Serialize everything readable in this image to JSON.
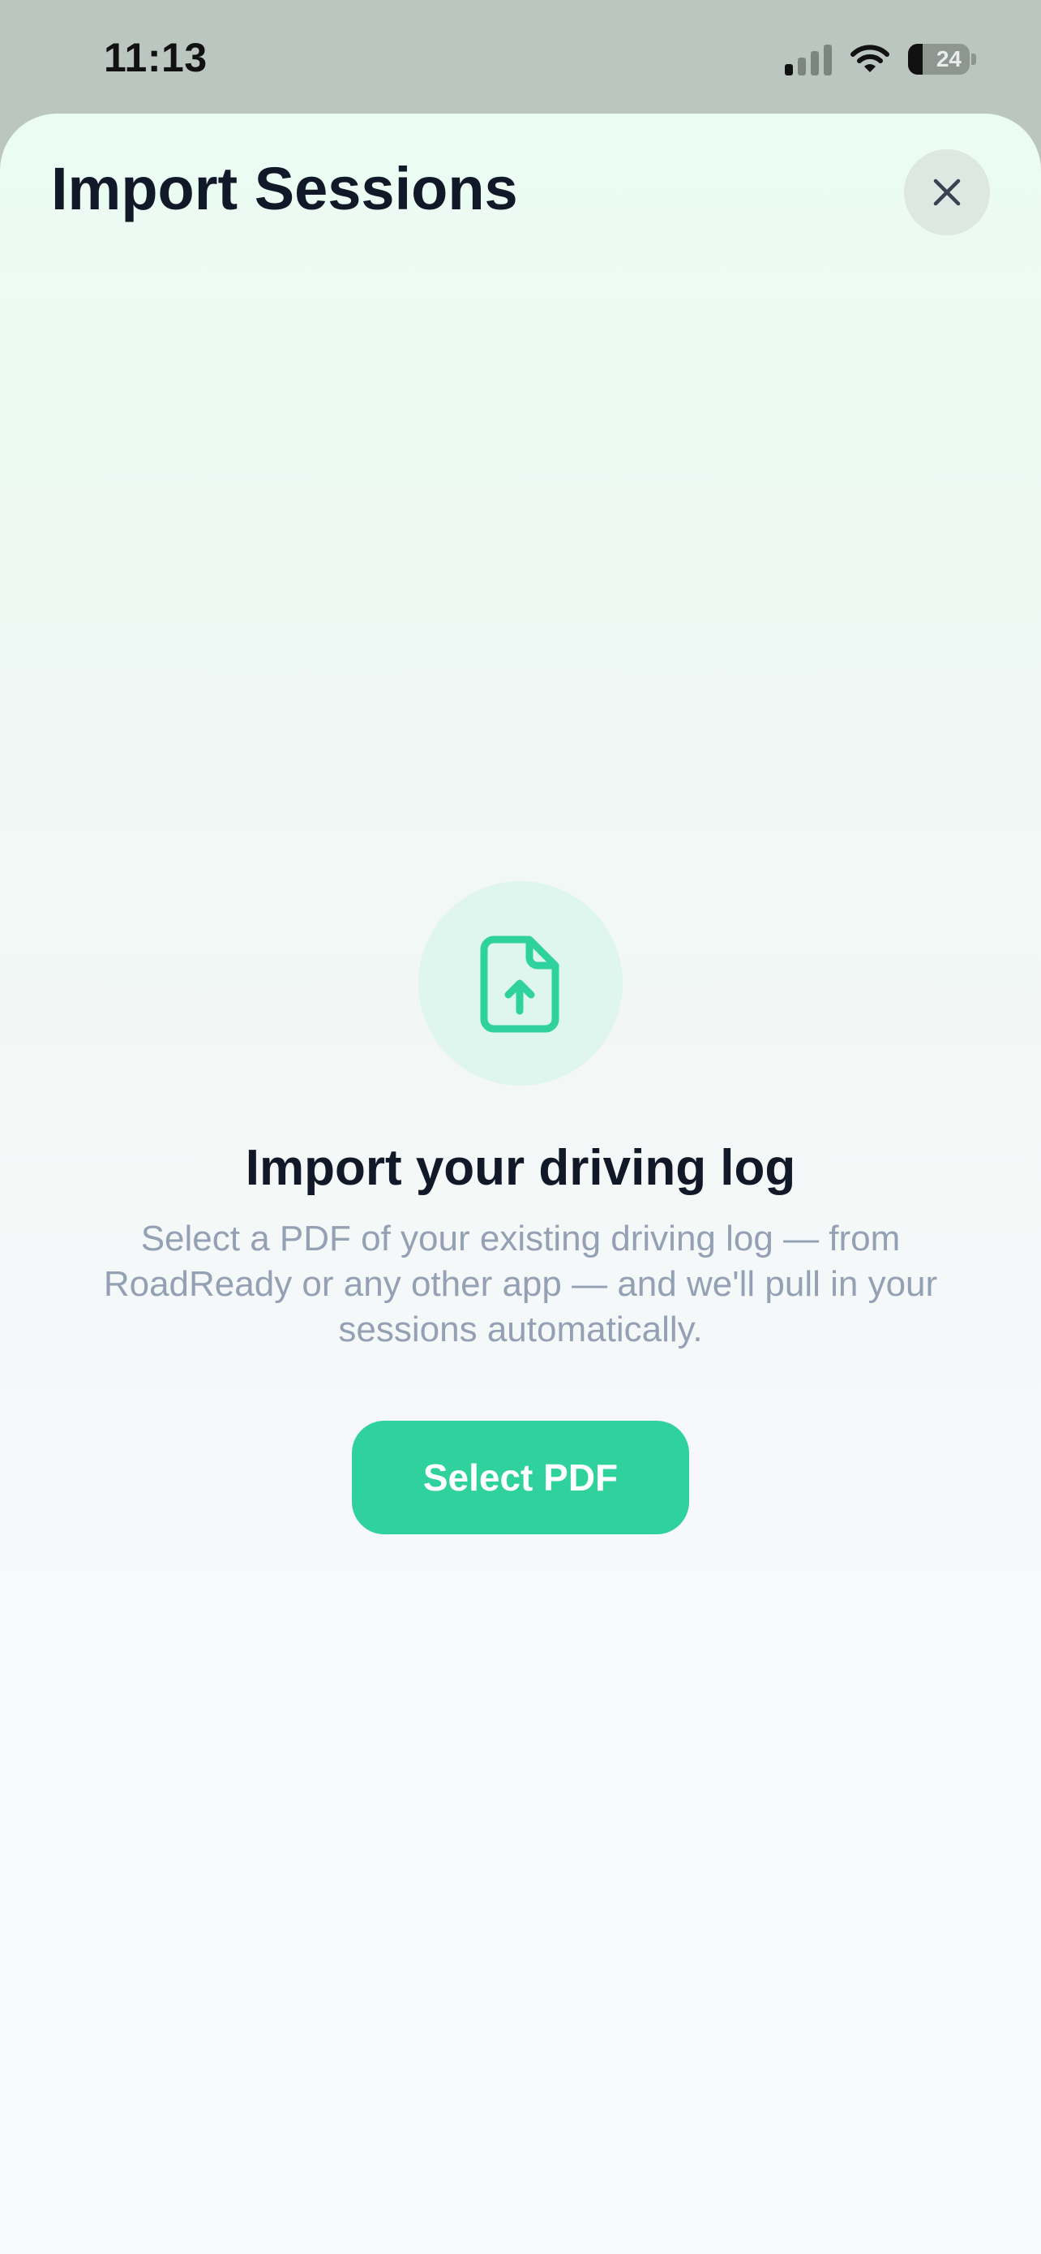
{
  "status_bar": {
    "time": "11:13",
    "battery_level": "24",
    "icons": [
      "cellular-signal-icon",
      "wifi-icon",
      "battery-icon"
    ]
  },
  "sheet": {
    "title": "Import Sessions",
    "close_icon": "close-icon"
  },
  "empty_state": {
    "icon": "file-upload-icon",
    "heading": "Import your driving log",
    "description": "Select a PDF of your existing driving log — from RoadReady or any other app — and we'll pull in your sessions automatically.",
    "button_label": "Select PDF"
  },
  "colors": {
    "accent": "#2fd29c",
    "heading_text": "#111827",
    "muted_text": "#94a0b3",
    "icon_circle": "#dff6ee",
    "close_button_bg": "#dde8e3"
  }
}
